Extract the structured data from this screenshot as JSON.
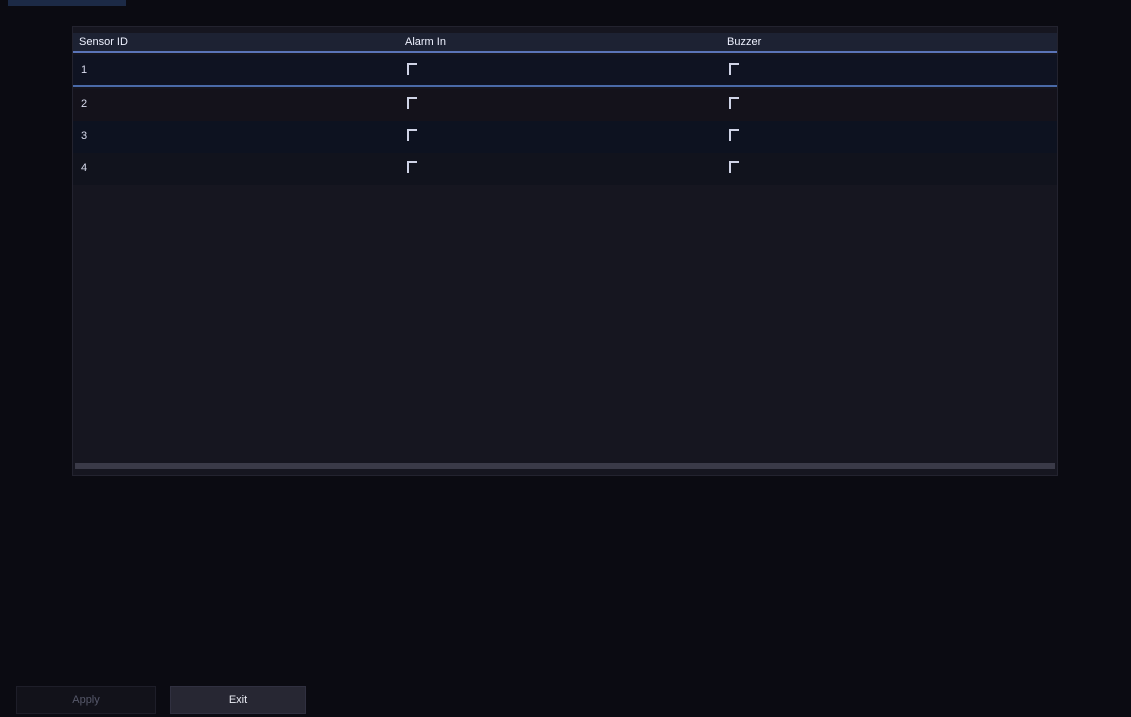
{
  "table": {
    "headers": {
      "sensor_id": "Sensor ID",
      "column_2": "Alarm In",
      "column_3": "Buzzer"
    },
    "rows": [
      {
        "id": "1",
        "checked_a": false,
        "checked_b": false
      },
      {
        "id": "2",
        "checked_a": false,
        "checked_b": false
      },
      {
        "id": "3",
        "checked_a": false,
        "checked_b": false
      },
      {
        "id": "4",
        "checked_a": false,
        "checked_b": false
      }
    ]
  },
  "buttons": {
    "apply_label": "Apply",
    "exit_label": "Exit"
  }
}
